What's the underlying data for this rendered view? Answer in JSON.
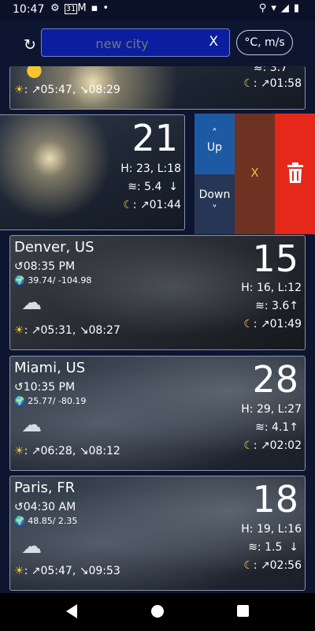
{
  "status_bar": {
    "time": "10:47",
    "icons": [
      "gear-icon",
      "calendar-31-icon",
      "gmail-icon",
      "sd-card-icon",
      "dot-icon"
    ],
    "calendar_day": "31",
    "right_icons": [
      "location-icon",
      "wifi-icon",
      "signal-icon",
      "battery-icon"
    ]
  },
  "toolbar": {
    "refresh_icon": "refresh-icon",
    "search_placeholder": "new city",
    "clear_label": "X",
    "units_label": "°C, m/s"
  },
  "cards": [
    {
      "city": "",
      "weather_icon": "sun-icon",
      "sunrise": "↗05:47",
      "sunset": "↘08:29",
      "moonrise": "↗01:58",
      "wind_partial": "3.7"
    },
    {
      "temp": "21",
      "hl": "H: 23, L:18",
      "wind": "5.4",
      "wind_dir": "↓",
      "moonrise": "↗01:44"
    },
    {
      "city": "Denver, US",
      "local_time": "08:35 PM",
      "coords": "39.74/ -104.98",
      "weather_icon": "rain-cloud-icon",
      "sunrise": "↗05:31",
      "sunset": "↘08:27",
      "temp": "15",
      "hl": "H: 16, L:12",
      "wind": "3.6",
      "wind_dir": "↑",
      "moonrise": "↗01:49"
    },
    {
      "city": "Miami, US",
      "local_time": "10:35 PM",
      "coords": "25.77/ -80.19",
      "weather_icon": "cloud-icon",
      "sunrise": "↗06:28",
      "sunset": "↘08:12",
      "temp": "28",
      "hl": "H: 29, L:27",
      "wind": "4.1",
      "wind_dir": "↑",
      "moonrise": "↗02:02"
    },
    {
      "city": "Paris, FR",
      "local_time": "04:30 AM",
      "coords": "48.85/ 2.35",
      "weather_icon": "cloud-icon",
      "sunrise": "↗05:47",
      "sunset": "↘09:53",
      "temp": "18",
      "hl": "H: 19, L:16",
      "wind": "1.5",
      "wind_dir": "↓",
      "moonrise": "↗02:56"
    }
  ],
  "swipe_actions": {
    "up_arrow": "˄",
    "up_label": "Up",
    "down_label": "Down",
    "down_arrow": "˅",
    "close_label": "X",
    "delete_icon": "trash-icon"
  },
  "nav_bar": {
    "back": "back-icon",
    "home": "home-icon",
    "recents": "recents-icon"
  },
  "colors": {
    "background": "#0e1530",
    "input_bg": "#0b1ea0",
    "up_button": "#1e5aa3",
    "down_button": "#273656",
    "close_button": "#6e3222",
    "delete_button": "#e5281a",
    "sun": "#f7c531"
  }
}
